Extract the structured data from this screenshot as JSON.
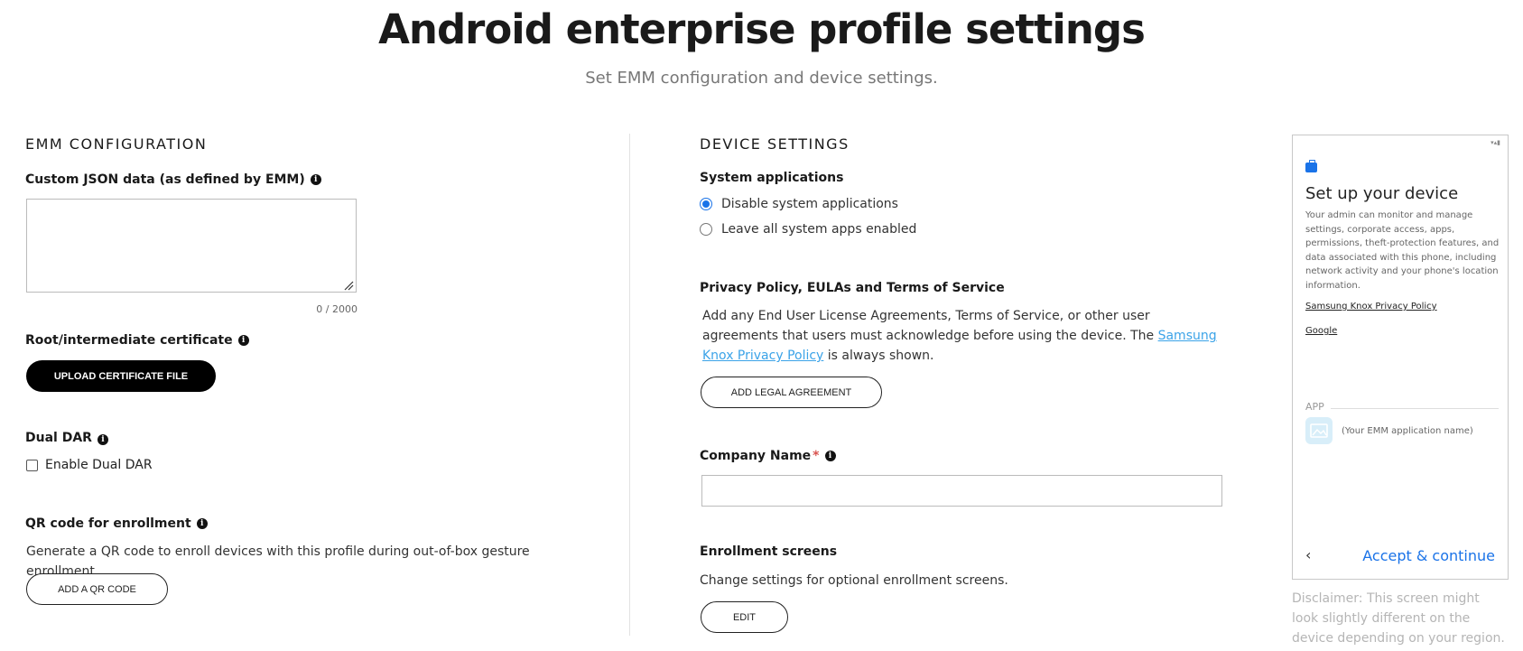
{
  "header": {
    "title": "Android enterprise profile settings",
    "subtitle": "Set EMM configuration and device settings."
  },
  "emm": {
    "heading": "EMM CONFIGURATION",
    "json_label": "Custom JSON data (as defined by EMM)",
    "json_value": "",
    "json_counter": "0 / 2000",
    "cert_label": "Root/intermediate certificate",
    "upload_button": "UPLOAD CERTIFICATE FILE",
    "dual_dar_label": "Dual DAR",
    "dual_dar_checkbox": "Enable Dual DAR",
    "dual_dar_checked": false,
    "qr_label": "QR code for enrollment",
    "qr_desc": "Generate a QR code to enroll devices with this profile during out-of-box gesture enrollment.",
    "qr_button": "ADD A QR CODE"
  },
  "device": {
    "heading": "DEVICE SETTINGS",
    "sysapps_label": "System applications",
    "sysapps_options": [
      "Disable system applications",
      "Leave all system apps enabled"
    ],
    "sysapps_selected": "Disable system applications",
    "privacy_label": "Privacy Policy, EULAs and Terms of Service",
    "privacy_desc_1": "Add any End User License Agreements, Terms of Service, or other user agreements that users must acknowledge before using the device. The ",
    "privacy_link": "Samsung Knox Privacy Policy",
    "privacy_desc_2": " is always shown.",
    "legal_button": "ADD LEGAL AGREEMENT",
    "company_label": "Company Name",
    "company_required": "*",
    "company_value": "",
    "enroll_label": "Enrollment screens",
    "enroll_desc": "Change settings for optional enrollment screens.",
    "edit_button": "EDIT"
  },
  "preview": {
    "title": "Set up your device",
    "desc": "Your admin can monitor and manage settings, corporate access, apps, permissions, theft-protection features, and data associated with this phone, including network activity and your phone's location information.",
    "link_knox": "Samsung Knox Privacy Policy",
    "link_google": "Google",
    "app_section": "APP",
    "app_name": "(Your EMM application name)",
    "back_glyph": "‹",
    "accept": "Accept & continue",
    "disclaimer": "Disclaimer: This screen might look slightly different on the device depending on your region."
  },
  "colors": {
    "accent": "#1a73e8",
    "link": "#3ba3e8",
    "required": "#d9534f"
  },
  "icons": {
    "info": "info-icon",
    "briefcase": "briefcase-icon",
    "image": "image-placeholder-icon",
    "back": "chevron-left-icon"
  }
}
